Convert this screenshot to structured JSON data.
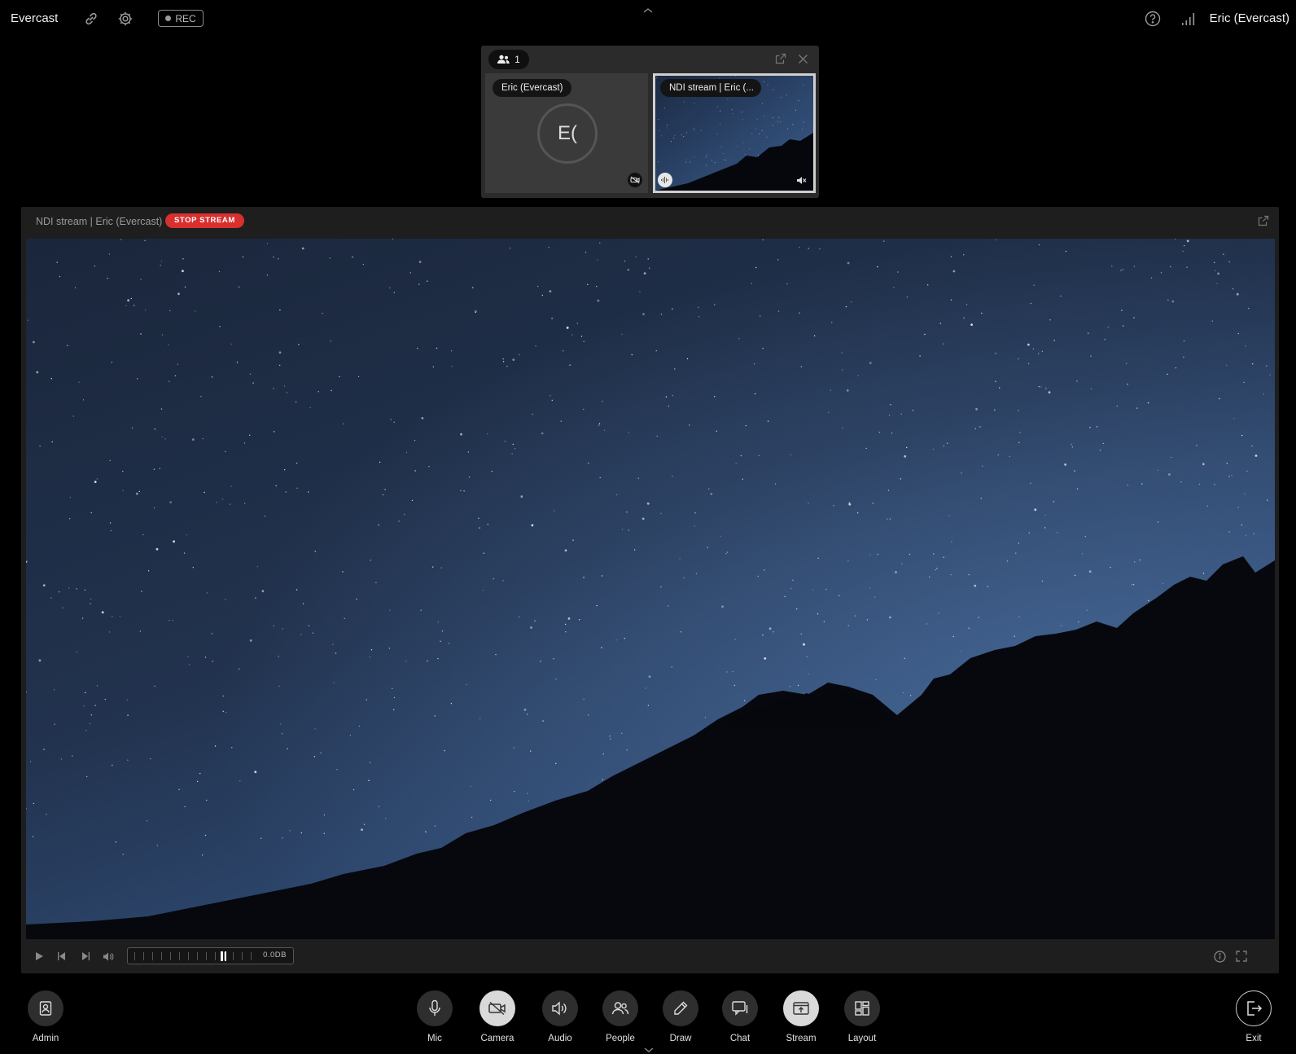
{
  "topbar": {
    "app_title": "Evercast",
    "rec_label": "REC",
    "user_name": "Eric (Evercast)",
    "icons": [
      "link-icon",
      "gear-icon",
      "help-icon",
      "signal-icon",
      "chevron-up-icon"
    ]
  },
  "participants": {
    "count": "1",
    "tiles": [
      {
        "label": "Eric (Evercast)",
        "initials": "E(",
        "status_icon": "camera-off-icon"
      },
      {
        "label": "NDI stream | Eric (...",
        "status_icon": "speaker-muted-icon",
        "audio_icon": "audio-wave-icon"
      }
    ]
  },
  "stage": {
    "title": "NDI stream | Eric (Evercast)",
    "stop_stream_label": "STOP STREAM",
    "audio_level": "0.0DB",
    "meter_level": 0.72
  },
  "dock": {
    "admin": "Admin",
    "mic": "Mic",
    "camera": "Camera",
    "audio": "Audio",
    "people": "People",
    "draw": "Draw",
    "chat": "Chat",
    "stream": "Stream",
    "layout": "Layout",
    "exit": "Exit"
  },
  "colors": {
    "accent_red": "#d82f2f",
    "active_button": "#d9d9d9",
    "background": "#000000"
  }
}
